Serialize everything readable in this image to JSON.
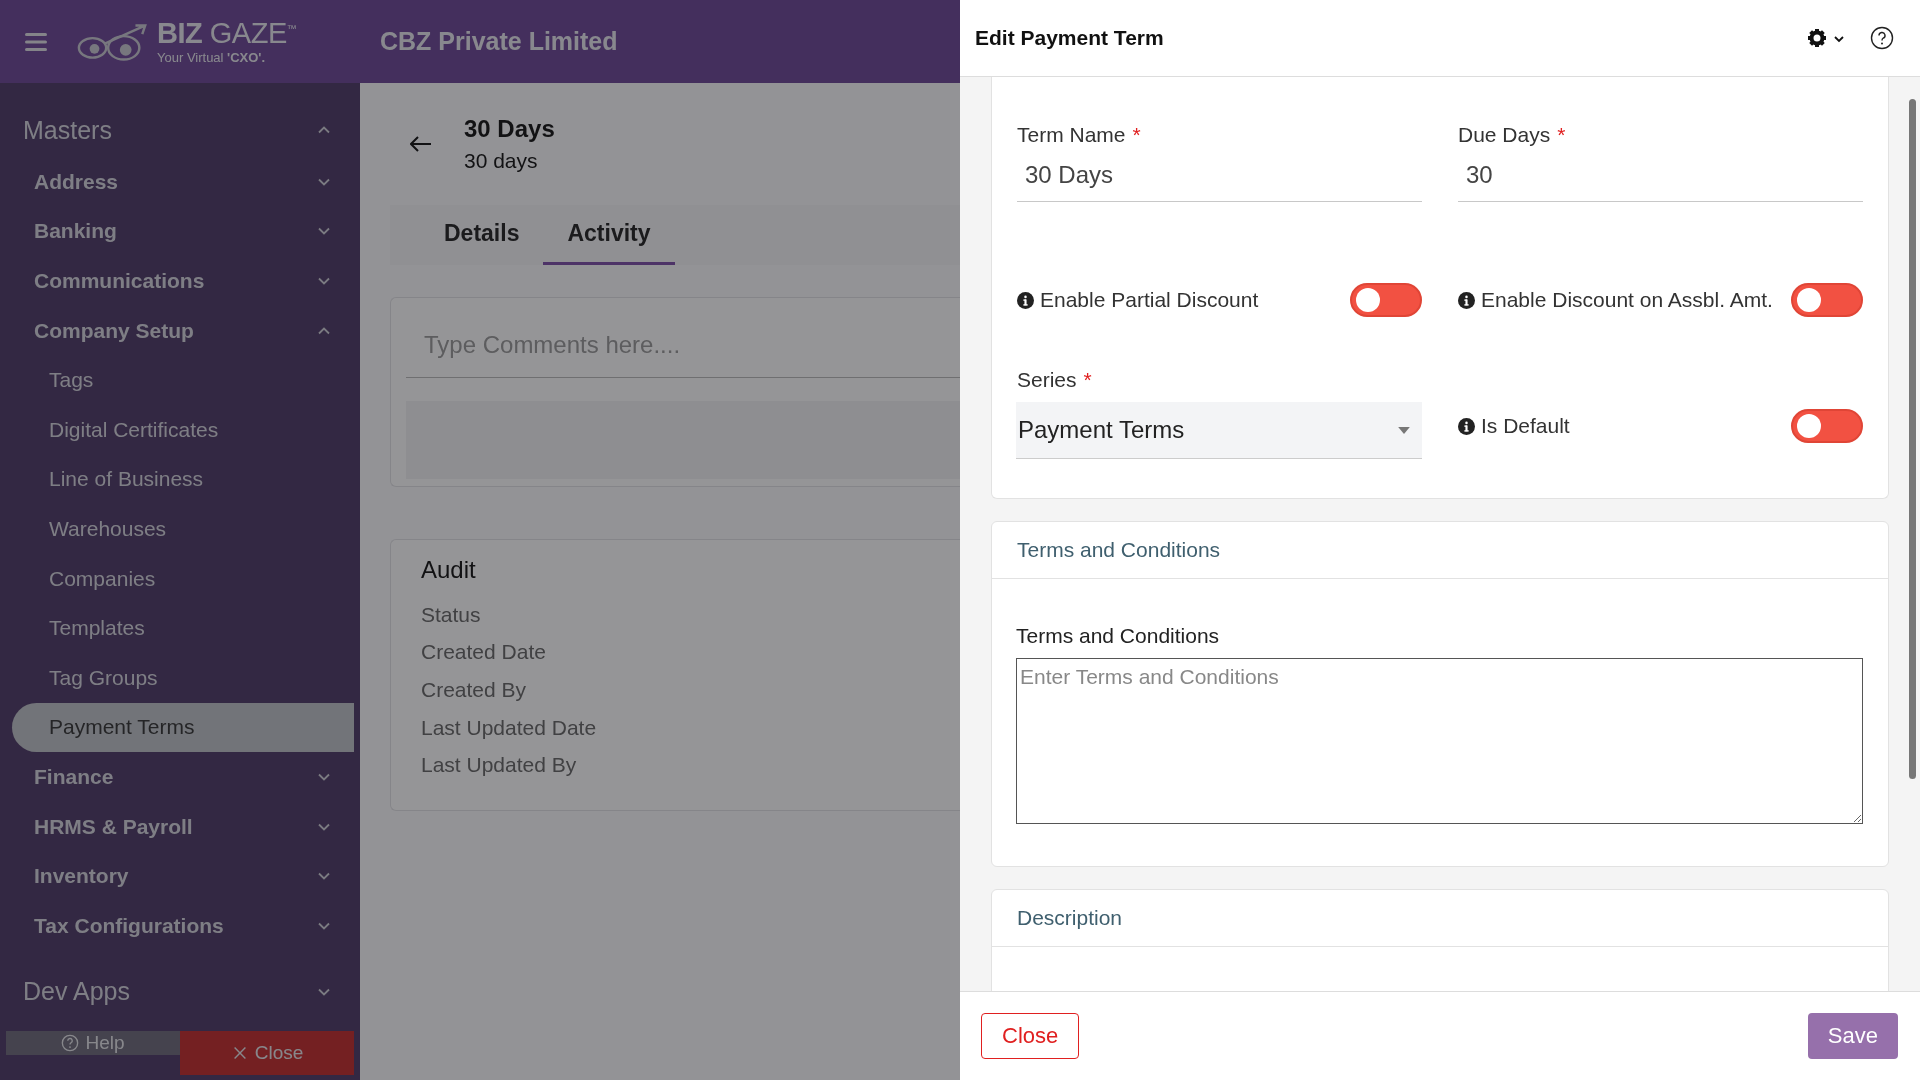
{
  "header": {
    "company": "CBZ Private Limited",
    "logo": {
      "brand_bold": "BIZ",
      "brand_light": "GAZE",
      "trademark": "™",
      "tagline": "Your Virtual ",
      "tagline_bold": "'CXO'."
    }
  },
  "sidebar": {
    "sections": [
      {
        "label": "Masters",
        "expanded": true,
        "children": [
          {
            "label": "Address",
            "expanded": false
          },
          {
            "label": "Banking",
            "expanded": false
          },
          {
            "label": "Communications",
            "expanded": false
          },
          {
            "label": "Company Setup",
            "expanded": true,
            "children": [
              {
                "label": "Tags",
                "selected": false
              },
              {
                "label": "Digital Certificates",
                "selected": false
              },
              {
                "label": "Line of Business",
                "selected": false
              },
              {
                "label": "Warehouses",
                "selected": false
              },
              {
                "label": "Companies",
                "selected": false
              },
              {
                "label": "Templates",
                "selected": false
              },
              {
                "label": "Tag Groups",
                "selected": false
              },
              {
                "label": "Payment Terms",
                "selected": true
              }
            ]
          },
          {
            "label": "Finance",
            "expanded": false
          },
          {
            "label": "HRMS & Payroll",
            "expanded": false
          },
          {
            "label": "Inventory",
            "expanded": false
          },
          {
            "label": "Tax Configurations",
            "expanded": false
          }
        ]
      },
      {
        "label": "Dev Apps",
        "expanded": false
      }
    ],
    "footer_buttons": [
      {
        "label": "Help",
        "kind": "help"
      },
      {
        "label": "Close",
        "kind": "close"
      }
    ]
  },
  "record": {
    "title": "30 Days",
    "subtitle": "30 days",
    "tabs": [
      {
        "label": "Details",
        "selected": false
      },
      {
        "label": "Activity",
        "selected": true
      }
    ],
    "comment": {
      "placeholder": "Type Comments here...."
    },
    "audit": {
      "title": "Audit",
      "fields": [
        "Status",
        "Created Date",
        "Created By",
        "Last Updated Date",
        "Last Updated By"
      ]
    }
  },
  "panel": {
    "title": "Edit Payment Term",
    "fields": [
      {
        "kind": "text",
        "label": "Term Name",
        "required_mark": "*",
        "value": "30 Days"
      },
      {
        "kind": "text",
        "label": "Due Days",
        "required_mark": "*",
        "value": "30"
      },
      {
        "kind": "toggle",
        "label": "Enable Partial Discount",
        "on": false
      },
      {
        "kind": "toggle",
        "label": "Enable Discount on Assbl. Amt.",
        "on": false
      },
      {
        "kind": "select",
        "label": "Series",
        "required_mark": "*",
        "value": "Payment Terms"
      },
      {
        "kind": "toggle",
        "label": "Is Default",
        "on": false
      }
    ],
    "terms": {
      "heading": "Terms and Conditions",
      "label": "Terms and Conditions",
      "placeholder": "Enter Terms and Conditions"
    },
    "description": {
      "heading": "Description"
    },
    "buttons": [
      {
        "label": "Close",
        "kind": "secondary"
      },
      {
        "label": "Save",
        "kind": "primary"
      }
    ]
  }
}
